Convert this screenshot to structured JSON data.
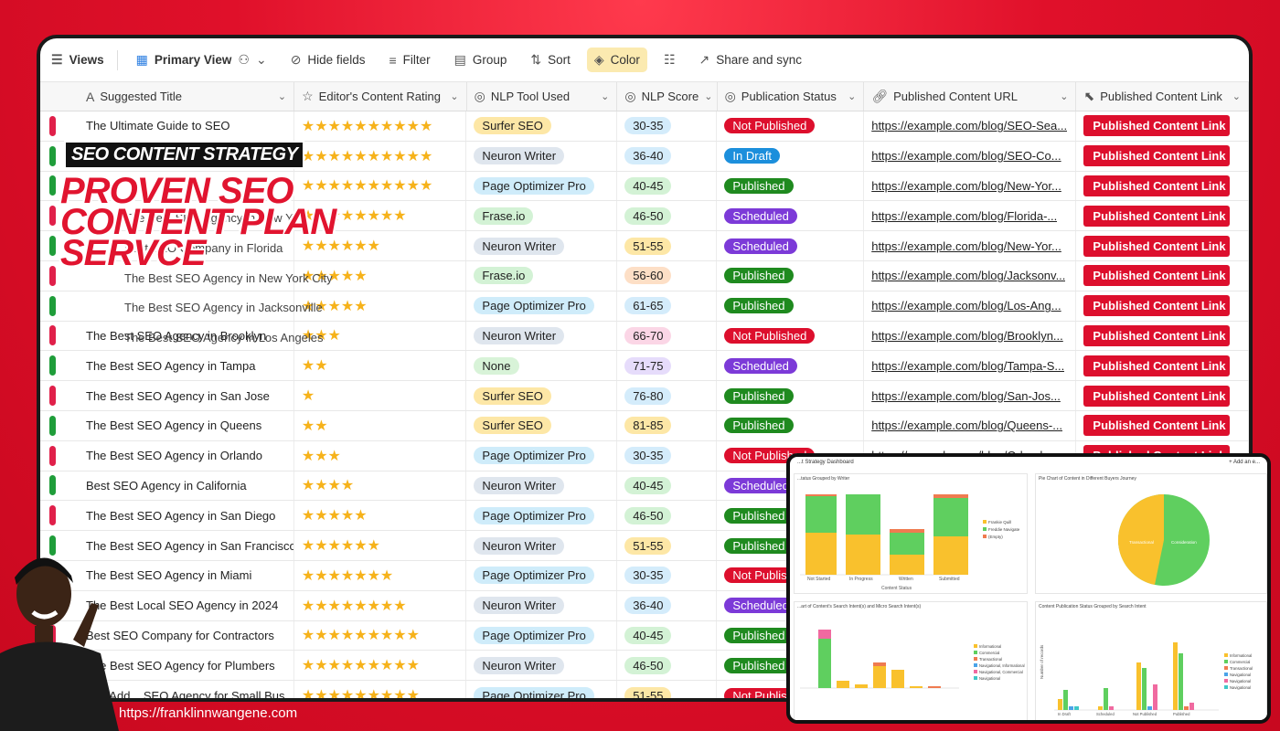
{
  "toolbar": {
    "views": "Views",
    "primary_view": "Primary View",
    "hide_fields": "Hide fields",
    "filter": "Filter",
    "group": "Group",
    "sort": "Sort",
    "color": "Color",
    "share": "Share and sync"
  },
  "columns": {
    "title": "Suggested Title",
    "rating": "Editor's Content Rating",
    "tool": "NLP Tool Used",
    "score": "NLP Score",
    "status": "Publication Status",
    "url": "Published Content URL",
    "link": "Published Content Link"
  },
  "rows": [
    {
      "title": "The Ultimate Guide to SEO",
      "stars": 10,
      "tool": "Surfer SEO",
      "score": "30-35",
      "status": "Not Published",
      "url": "https://example.com/blog/SEO-Sea...",
      "link": "Published Content Link",
      "ind": "red"
    },
    {
      "title": "",
      "stars": 10,
      "tool": "Neuron Writer",
      "score": "36-40",
      "status": "In Draft",
      "url": "https://example.com/blog/SEO-Co...",
      "link": "Published Content Link",
      "ind": "green"
    },
    {
      "title": "",
      "stars": 10,
      "tool": "Page Optimizer Pro",
      "score": "40-45",
      "status": "Published",
      "url": "https://example.com/blog/New-Yor...",
      "link": "Published Content Link",
      "ind": "green"
    },
    {
      "title": "",
      "stars": 8,
      "tool": "Frase.io",
      "score": "46-50",
      "status": "Scheduled",
      "url": "https://example.com/blog/Florida-...",
      "link": "Published Content Link",
      "ind": "red"
    },
    {
      "title": "",
      "stars": 6,
      "tool": "Neuron Writer",
      "score": "51-55",
      "status": "Scheduled",
      "url": "https://example.com/blog/New-Yor...",
      "link": "Published Content Link",
      "ind": "green"
    },
    {
      "title": "",
      "stars": 5,
      "tool": "Frase.io",
      "score": "56-60",
      "status": "Published",
      "url": "https://example.com/blog/Jacksonv...",
      "link": "Published Content Link",
      "ind": "red"
    },
    {
      "title": "",
      "stars": 5,
      "tool": "Page Optimizer Pro",
      "score": "61-65",
      "status": "Published",
      "url": "https://example.com/blog/Los-Ang...",
      "link": "Published Content Link",
      "ind": "green"
    },
    {
      "title": "The Best SEO Agency in Brooklyn",
      "stars": 3,
      "tool": "Neuron Writer",
      "score": "66-70",
      "status": "Not Published",
      "url": "https://example.com/blog/Brooklyn...",
      "link": "Published Content Link",
      "ind": "red"
    },
    {
      "title": "The Best SEO Agency in Tampa",
      "stars": 2,
      "tool": "None",
      "score": "71-75",
      "status": "Scheduled",
      "url": "https://example.com/blog/Tampa-S...",
      "link": "Published Content Link",
      "ind": "green"
    },
    {
      "title": "The Best SEO Agency in San Jose",
      "stars": 1,
      "tool": "Surfer SEO",
      "score": "76-80",
      "status": "Published",
      "url": "https://example.com/blog/San-Jos...",
      "link": "Published Content Link",
      "ind": "red"
    },
    {
      "title": "The Best SEO Agency in Queens",
      "stars": 2,
      "tool": "Surfer SEO",
      "score": "81-85",
      "status": "Published",
      "url": "https://example.com/blog/Queens-...",
      "link": "Published Content Link",
      "ind": "green"
    },
    {
      "title": "The Best SEO Agency in Orlando",
      "stars": 3,
      "tool": "Page Optimizer Pro",
      "score": "30-35",
      "status": "Not Published",
      "url": "https://example.com/blog/Orlando...",
      "link": "Published Content Link",
      "ind": "red"
    },
    {
      "title": "Best SEO Agency in California",
      "stars": 4,
      "tool": "Neuron Writer",
      "score": "40-45",
      "status": "Scheduled",
      "url": "",
      "link": "",
      "ind": "green"
    },
    {
      "title": "The Best SEO Agency in San Diego",
      "stars": 5,
      "tool": "Page Optimizer Pro",
      "score": "46-50",
      "status": "Published",
      "url": "",
      "link": "",
      "ind": "red"
    },
    {
      "title": "The Best SEO Agency in San Francisco",
      "stars": 6,
      "tool": "Neuron Writer",
      "score": "51-55",
      "status": "Published",
      "url": "",
      "link": "",
      "ind": "green"
    },
    {
      "title": "The Best SEO Agency in Miami",
      "stars": 7,
      "tool": "Page Optimizer Pro",
      "score": "30-35",
      "status": "Not Published",
      "url": "",
      "link": "",
      "ind": "red"
    },
    {
      "title": "The Best Local SEO Agency in 2024",
      "stars": 8,
      "tool": "Neuron Writer",
      "score": "36-40",
      "status": "Scheduled",
      "url": "",
      "link": "",
      "ind": "green"
    },
    {
      "title": "Best SEO Company for Contractors",
      "stars": 9,
      "tool": "Page Optimizer Pro",
      "score": "40-45",
      "status": "Published",
      "url": "",
      "link": "",
      "ind": "red"
    },
    {
      "title": "The Best SEO Agency for Plumbers",
      "stars": 9,
      "tool": "Neuron Writer",
      "score": "46-50",
      "status": "Published",
      "url": "",
      "link": "",
      "ind": "green"
    },
    {
      "title": "The Add... SEO Agency for Small Bus...",
      "stars": 9,
      "tool": "Page Optimizer Pro",
      "score": "51-55",
      "status": "Not Published",
      "url": "",
      "link": "",
      "ind": "red"
    }
  ],
  "partial_titles": {
    "r2": "The Best SEO Agency in New York",
    "r3": "Best SEO Company in Florida",
    "r4": "The Best SEO Agency in New York City",
    "r5": "The Best SEO Agency in Jacksonville",
    "r6": "The Best SEO Agency in Los Angeles"
  },
  "overlay": {
    "badge": "SEO CONTENT STRATEGY",
    "headline": "PROVEN SEO CONTENT PLAN SERVCE",
    "footer_url": "https://franklinnwangene.com"
  },
  "dashboard": {
    "title": "...t Strategy Dashboard",
    "add": "+ Add an e...",
    "p1_title": "...tatus Grouped by Writer",
    "p1_xlabel": "Content Status",
    "p1_categories": [
      "Not Started",
      "In Progress",
      "Written",
      "Submitted"
    ],
    "p1_legend": [
      "Frankie Quill",
      "Freddie Navigate",
      "(Empty)"
    ],
    "p2_title": "Pie Chart of Content in Different Buyers Journey",
    "p2_labels": [
      "Transactional",
      "Consideration"
    ],
    "p3_title": "...art of Content's Search Intent(s) and Micro Search Intent(s)",
    "p3_legend": [
      "Informational",
      "Commercial",
      "Transactional",
      "Navigational, Informational",
      "Navigational, Commercial",
      "Navigational"
    ],
    "p4_title": "Content Publication Status Grouped by Search Intent",
    "p4_ylabel": "Number of records",
    "p4_categories": [
      "In Draft",
      "Scheduled",
      "Not Published",
      "Published"
    ],
    "p4_legend": [
      "Informational",
      "Commercial",
      "Transactional",
      "Navigational",
      "Navigational",
      "Navigational"
    ]
  },
  "colors": {
    "accent": "#e0102a",
    "status": {
      "Not Published": "#dd0f2d",
      "In Draft": "#1c8fdc",
      "Published": "#1f8a1f",
      "Scheduled": "#7c3ad8"
    },
    "tools": {
      "Surfer SEO": "#fde7a6",
      "Neuron Writer": "#dfe6ee",
      "Page Optimizer Pro": "#cfecfa",
      "Frase.io": "#d3f2d5",
      "None": "#d8f3d8"
    },
    "scores": {
      "30-35": "#d4ecfb",
      "36-40": "#d4ecfb",
      "40-45": "#d3f2d5",
      "46-50": "#d3f2d5",
      "51-55": "#fde7a6",
      "56-60": "#fddfc6",
      "61-65": "#d4ecfb",
      "66-70": "#fbd6e6",
      "71-75": "#e6dcfb",
      "76-80": "#d4ecfb",
      "81-85": "#fde7a6"
    }
  }
}
